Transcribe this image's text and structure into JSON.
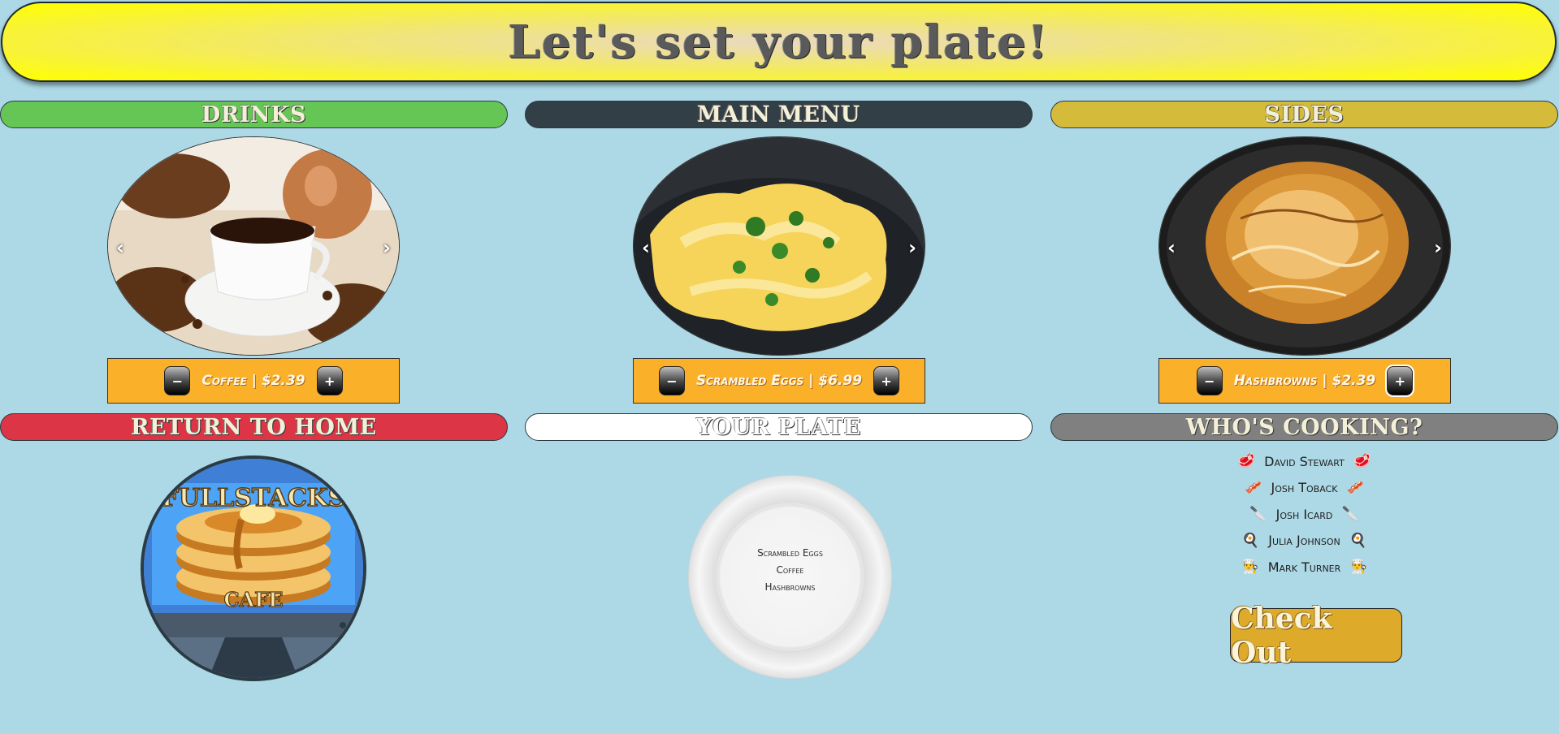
{
  "title": "Let's set your plate!",
  "sections": {
    "drinks": "DRINKS",
    "main_menu": "MAIN MENU",
    "sides": "SIDES",
    "home": "RETURN TO HOME",
    "plate": "YOUR PLATE",
    "cooking": "WHO'S COOKING?"
  },
  "colors": {
    "background": "#add8e6",
    "drinks_header": "#66c655",
    "main_header": "#333f47",
    "sides_header": "#d4bb3a",
    "home_header": "#dc3545",
    "plate_header": "#ffffff",
    "cooking_header": "#808080",
    "order_bar": "#fbb02a"
  },
  "carousel": {
    "prev": "‹",
    "next": "›"
  },
  "orders": {
    "drink": {
      "minus": "−",
      "label": "Coffee | $2.39",
      "plus": "+"
    },
    "main": {
      "minus": "−",
      "label": "Scrambled Eggs | $6.99",
      "plus": "+"
    },
    "side": {
      "minus": "−",
      "label": "Hashbrowns | $2.39",
      "plus": "+"
    }
  },
  "logo": {
    "line1": "FULLSTACKS",
    "line2": "CAFE"
  },
  "plate_items": [
    "Scrambled Eggs",
    "Coffee",
    "Hashbrowns"
  ],
  "cooks": [
    {
      "name": "David Stewart",
      "icon": "🥩",
      "icon_name": "steak-icon"
    },
    {
      "name": "Josh Toback",
      "icon": "🥓",
      "icon_name": "bacon-icon"
    },
    {
      "name": "Josh Icard",
      "icon": "🔪",
      "icon_name": "knife-icon"
    },
    {
      "name": "Julia Johnson",
      "icon": "🍳",
      "icon_name": "frying-pan-icon"
    },
    {
      "name": "Mark Turner",
      "icon": "👨‍🍳",
      "icon_name": "chef-icon"
    }
  ],
  "checkout": "Check Out"
}
